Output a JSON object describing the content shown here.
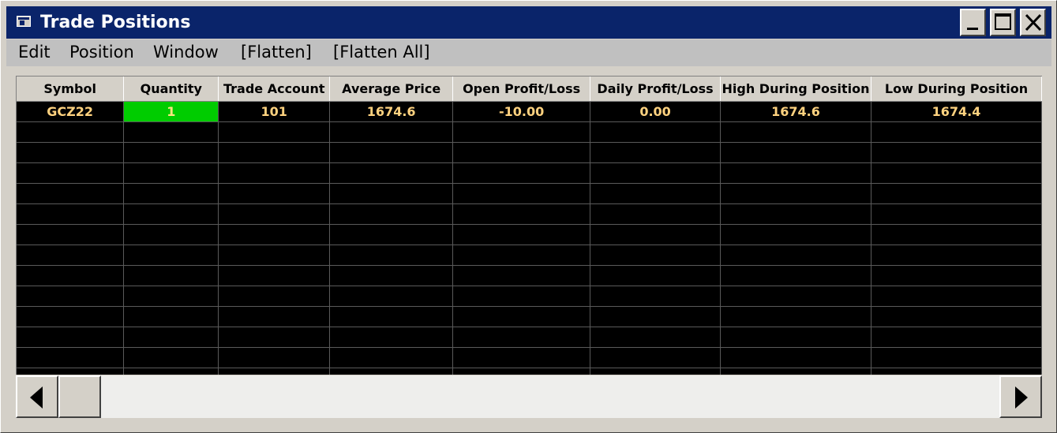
{
  "window": {
    "title": "Trade Positions",
    "controls": {
      "minimize": "minimize",
      "maximize": "maximize",
      "close": "close"
    }
  },
  "menu": {
    "items": [
      "Edit",
      "Position",
      "Window",
      "[Flatten]",
      "[Flatten All]"
    ]
  },
  "grid": {
    "columns": [
      "Symbol",
      "Quantity",
      "Trade Account",
      "Average Price",
      "Open Profit/Loss",
      "Daily Profit/Loss",
      "High During Position",
      "Low During Position"
    ],
    "rows": [
      [
        "GCZ22",
        "1",
        "101",
        "1674.6",
        "-10.00",
        "0.00",
        "1674.6",
        "1674.4"
      ]
    ]
  },
  "colors": {
    "title_bar": "#0a246a",
    "grid_background": "#000000",
    "cell_text": "#ffd27f",
    "quantity_highlight": "#00cc00"
  },
  "icons": [
    "window-app-icon",
    "minimize-icon",
    "maximize-icon",
    "close-icon",
    "scroll-left-arrow-icon",
    "scroll-right-arrow-icon"
  ]
}
